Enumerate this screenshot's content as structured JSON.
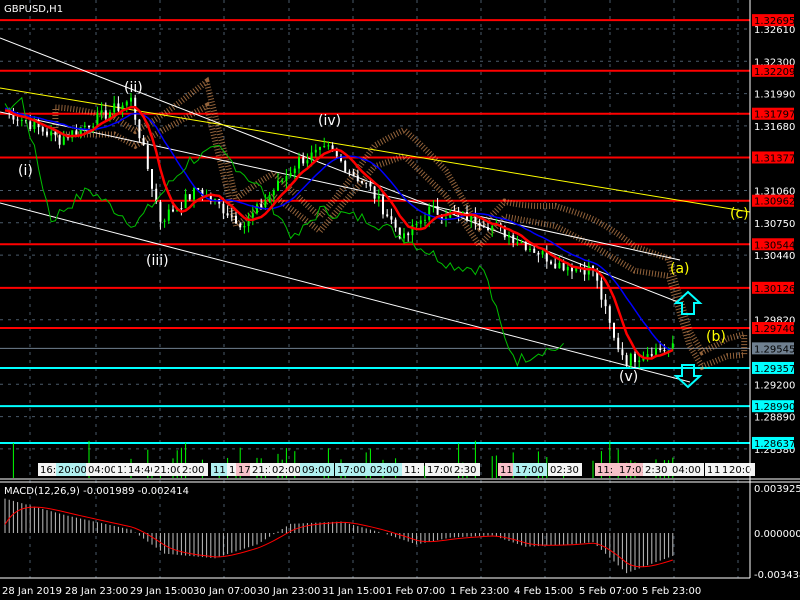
{
  "symbol_label": "GBPUSD,H1",
  "macd_label": "MACD(12,26,9) -0.001989 -0.002414",
  "colors": {
    "bg": "#000000",
    "resistance": "#ff0000",
    "support": "#00ffff",
    "current": "#708090",
    "axis": "#ffffff",
    "bull": "#00ff00",
    "bear": "#ffffff",
    "ma": "#ff0000",
    "kijun": "#0000ff",
    "chikou": "#00c000",
    "cloud": "#f4a460",
    "trend": "#ffffff",
    "yellow_trend": "#ffff00",
    "wave": "#ffff00"
  },
  "chart_data": {
    "type": "line",
    "title": "GBPUSD,H1",
    "ylim": [
      1.2848,
      1.3288
    ],
    "price_ticks": [
      "1.32610",
      "1.32300",
      "1.31990",
      "1.31680",
      "1.31060",
      "1.30750",
      "1.30440",
      "1.29820",
      "1.29200",
      "1.28890",
      "1.28580"
    ],
    "resistance_levels": [
      "1.32695",
      "1.32209",
      "1.31797",
      "1.31377",
      "1.30962",
      "1.30544",
      "1.30126",
      "1.29740"
    ],
    "current_price": "1.29545",
    "support_levels": [
      "1.29357",
      "1.28990",
      "1.28637"
    ],
    "time_labels": [
      "28 Jan 2019",
      "28 Jan 23:00",
      "29 Jan 15:00",
      "30 Jan 07:00",
      "30 Jan 23:00",
      "31 Jan 15:00",
      "1 Feb 07:00",
      "1 Feb 23:00",
      "4 Feb 15:00",
      "5 Feb 07:00",
      "5 Feb 23:00"
    ],
    "price_path": [
      [
        0,
        1.3183
      ],
      [
        13,
        1.3155
      ],
      [
        30,
        1.3193
      ],
      [
        37,
        1.3078
      ],
      [
        46,
        1.3107
      ],
      [
        57,
        1.3073
      ],
      [
        70,
        1.3135
      ],
      [
        77,
        1.3145
      ],
      [
        87,
        1.3107
      ],
      [
        95,
        1.3059
      ],
      [
        101,
        1.3087
      ],
      [
        113,
        1.3078
      ],
      [
        122,
        1.3059
      ],
      [
        132,
        1.3035
      ],
      [
        140,
        1.303
      ],
      [
        145,
        1.2963
      ],
      [
        148,
        1.2943
      ],
      [
        154,
        1.2953
      ],
      [
        159,
        1.29545
      ]
    ],
    "wave_labels": [
      "(i)",
      "(ii)",
      "(iii)",
      "(iv)",
      "(v)",
      "(a)",
      "(b)",
      "(c)"
    ],
    "session_tags": [
      "16:",
      "20:00",
      "04:00",
      "11",
      "14:40",
      "21:00",
      "2:00",
      "11",
      "1",
      "17:",
      "21:3",
      "02:00",
      "09:00",
      "17:00",
      "02:00",
      "11:",
      "17:00",
      "2:30",
      "11:",
      "17:00",
      "02:30",
      "11:",
      "17:01",
      "2:30",
      "04:00",
      "1",
      "1",
      "1:",
      "20:0"
    ],
    "macd": {
      "name": "MACD(12,26,9)",
      "value": "-0.001989",
      "signal": "-0.002414",
      "ticks": [
        "0.003925",
        "0.000000",
        "-0.003438"
      ],
      "ylim": [
        -0.003438,
        0.003925
      ],
      "hist_path": [
        [
          0,
          0.003
        ],
        [
          15,
          0.0015
        ],
        [
          30,
          0.0003
        ],
        [
          38,
          -0.0018
        ],
        [
          50,
          -0.0022
        ],
        [
          60,
          -0.001
        ],
        [
          68,
          0.0008
        ],
        [
          80,
          0.001
        ],
        [
          90,
          0.0
        ],
        [
          98,
          -0.001
        ],
        [
          106,
          -0.0004
        ],
        [
          116,
          -0.0002
        ],
        [
          124,
          -0.0012
        ],
        [
          134,
          -0.001
        ],
        [
          140,
          -0.0008
        ],
        [
          148,
          -0.0035
        ],
        [
          159,
          -0.002
        ]
      ]
    }
  }
}
